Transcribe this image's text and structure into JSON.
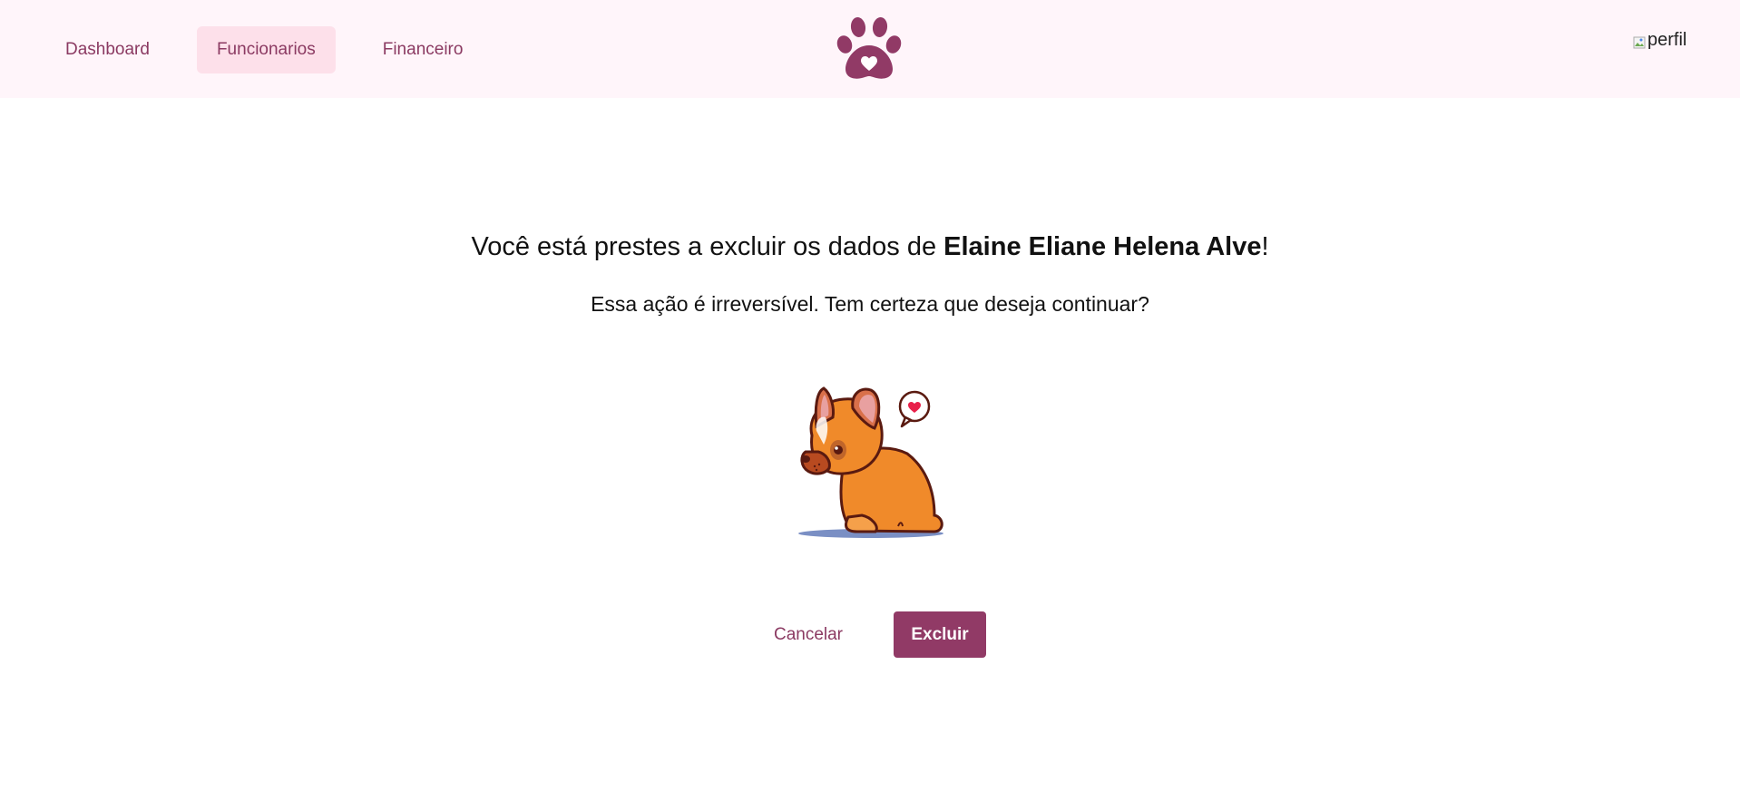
{
  "nav": {
    "items": [
      {
        "label": "Dashboard",
        "active": false
      },
      {
        "label": "Funcionarios",
        "active": true
      },
      {
        "label": "Financeiro",
        "active": false
      }
    ]
  },
  "logo": {
    "icon": "paw-heart-icon",
    "color": "#913a66"
  },
  "profile": {
    "alt_text": "perfil"
  },
  "dialog": {
    "title_prefix": "Você está prestes a excluir os dados de ",
    "name": "Elaine Eliane Helena Alve",
    "title_suffix": "!",
    "message": "Essa ação é irreversível. Tem certeza que deseja continuar?"
  },
  "illustration": {
    "icon": "sad-bulldog-illustration"
  },
  "actions": {
    "cancel_label": "Cancelar",
    "delete_label": "Excluir"
  },
  "colors": {
    "accent": "#913a66",
    "nav_active_bg": "#fde0ea",
    "topbar_bg": "#fff5fa"
  }
}
